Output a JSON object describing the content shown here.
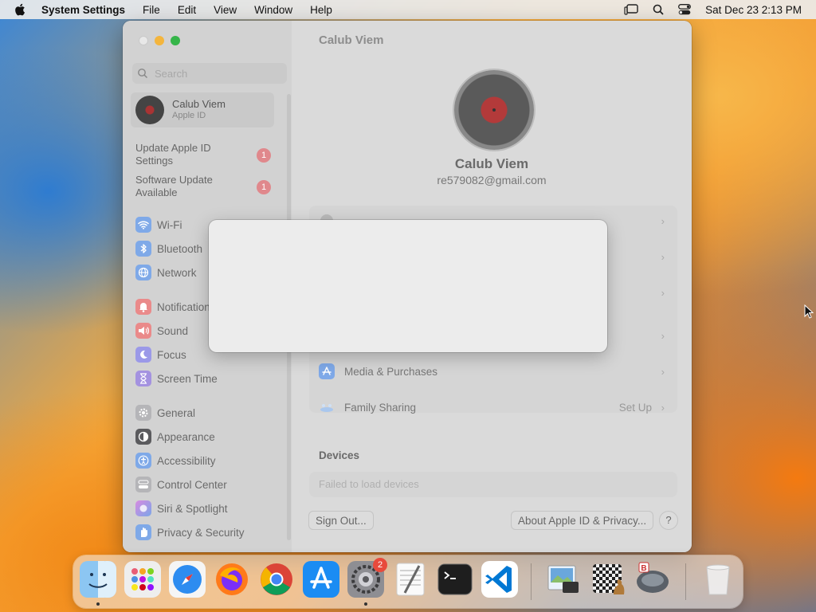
{
  "menubar": {
    "app_name": "System Settings",
    "items": [
      "File",
      "Edit",
      "View",
      "Window",
      "Help"
    ],
    "clock": "Sat Dec 23  2:13 PM"
  },
  "window": {
    "title": "Calub Viem",
    "sidebar": {
      "search_placeholder": "Search",
      "apple_id": {
        "name": "Calub Viem",
        "subtitle": "Apple ID"
      },
      "notices": [
        {
          "label": "Update Apple ID Settings",
          "badge": "1"
        },
        {
          "label": "Software Update Available",
          "badge": "1"
        }
      ],
      "groups": [
        [
          {
            "label": "Wi-Fi",
            "icon": "wifi-icon",
            "color": "#3b82f6"
          },
          {
            "label": "Bluetooth",
            "icon": "bluetooth-icon",
            "color": "#3b82f6"
          },
          {
            "label": "Network",
            "icon": "globe-icon",
            "color": "#3b82f6"
          }
        ],
        [
          {
            "label": "Notifications",
            "icon": "bell-icon",
            "color": "#ef4444"
          },
          {
            "label": "Sound",
            "icon": "speaker-icon",
            "color": "#ef4444"
          },
          {
            "label": "Focus",
            "icon": "moon-icon",
            "color": "#6366f1"
          },
          {
            "label": "Screen Time",
            "icon": "hourglass-icon",
            "color": "#6d4fd8"
          }
        ],
        [
          {
            "label": "General",
            "icon": "gear-icon",
            "color": "#8e8e93"
          },
          {
            "label": "Appearance",
            "icon": "appearance-icon",
            "color": "#1c1c1e"
          },
          {
            "label": "Accessibility",
            "icon": "accessibility-icon",
            "color": "#3b82f6"
          },
          {
            "label": "Control Center",
            "icon": "control-center-icon",
            "color": "#8e8e93"
          },
          {
            "label": "Siri & Spotlight",
            "icon": "siri-icon",
            "color": "#c026d3"
          },
          {
            "label": "Privacy & Security",
            "icon": "hand-icon",
            "color": "#3b82f6"
          }
        ]
      ]
    },
    "main": {
      "name": "Calub Viem",
      "email": "re579082@gmail.com",
      "rows": [
        {
          "label": "Media & Purchases",
          "value": ""
        },
        {
          "label": "Family Sharing",
          "value": "Set Up"
        }
      ],
      "devices_heading": "Devices",
      "devices_status": "Failed to load devices",
      "sign_out": "Sign Out...",
      "about": "About Apple ID & Privacy...",
      "help": "?"
    }
  },
  "dock": {
    "apps": [
      "Finder",
      "Launchpad",
      "Safari",
      "Firefox",
      "Chrome",
      "App Store",
      "System Settings",
      "TextEdit",
      "Terminal",
      "Visual Studio Code",
      "Preview",
      "Chess",
      "Automator"
    ],
    "system_settings_badge": "2",
    "trash": "Trash"
  }
}
